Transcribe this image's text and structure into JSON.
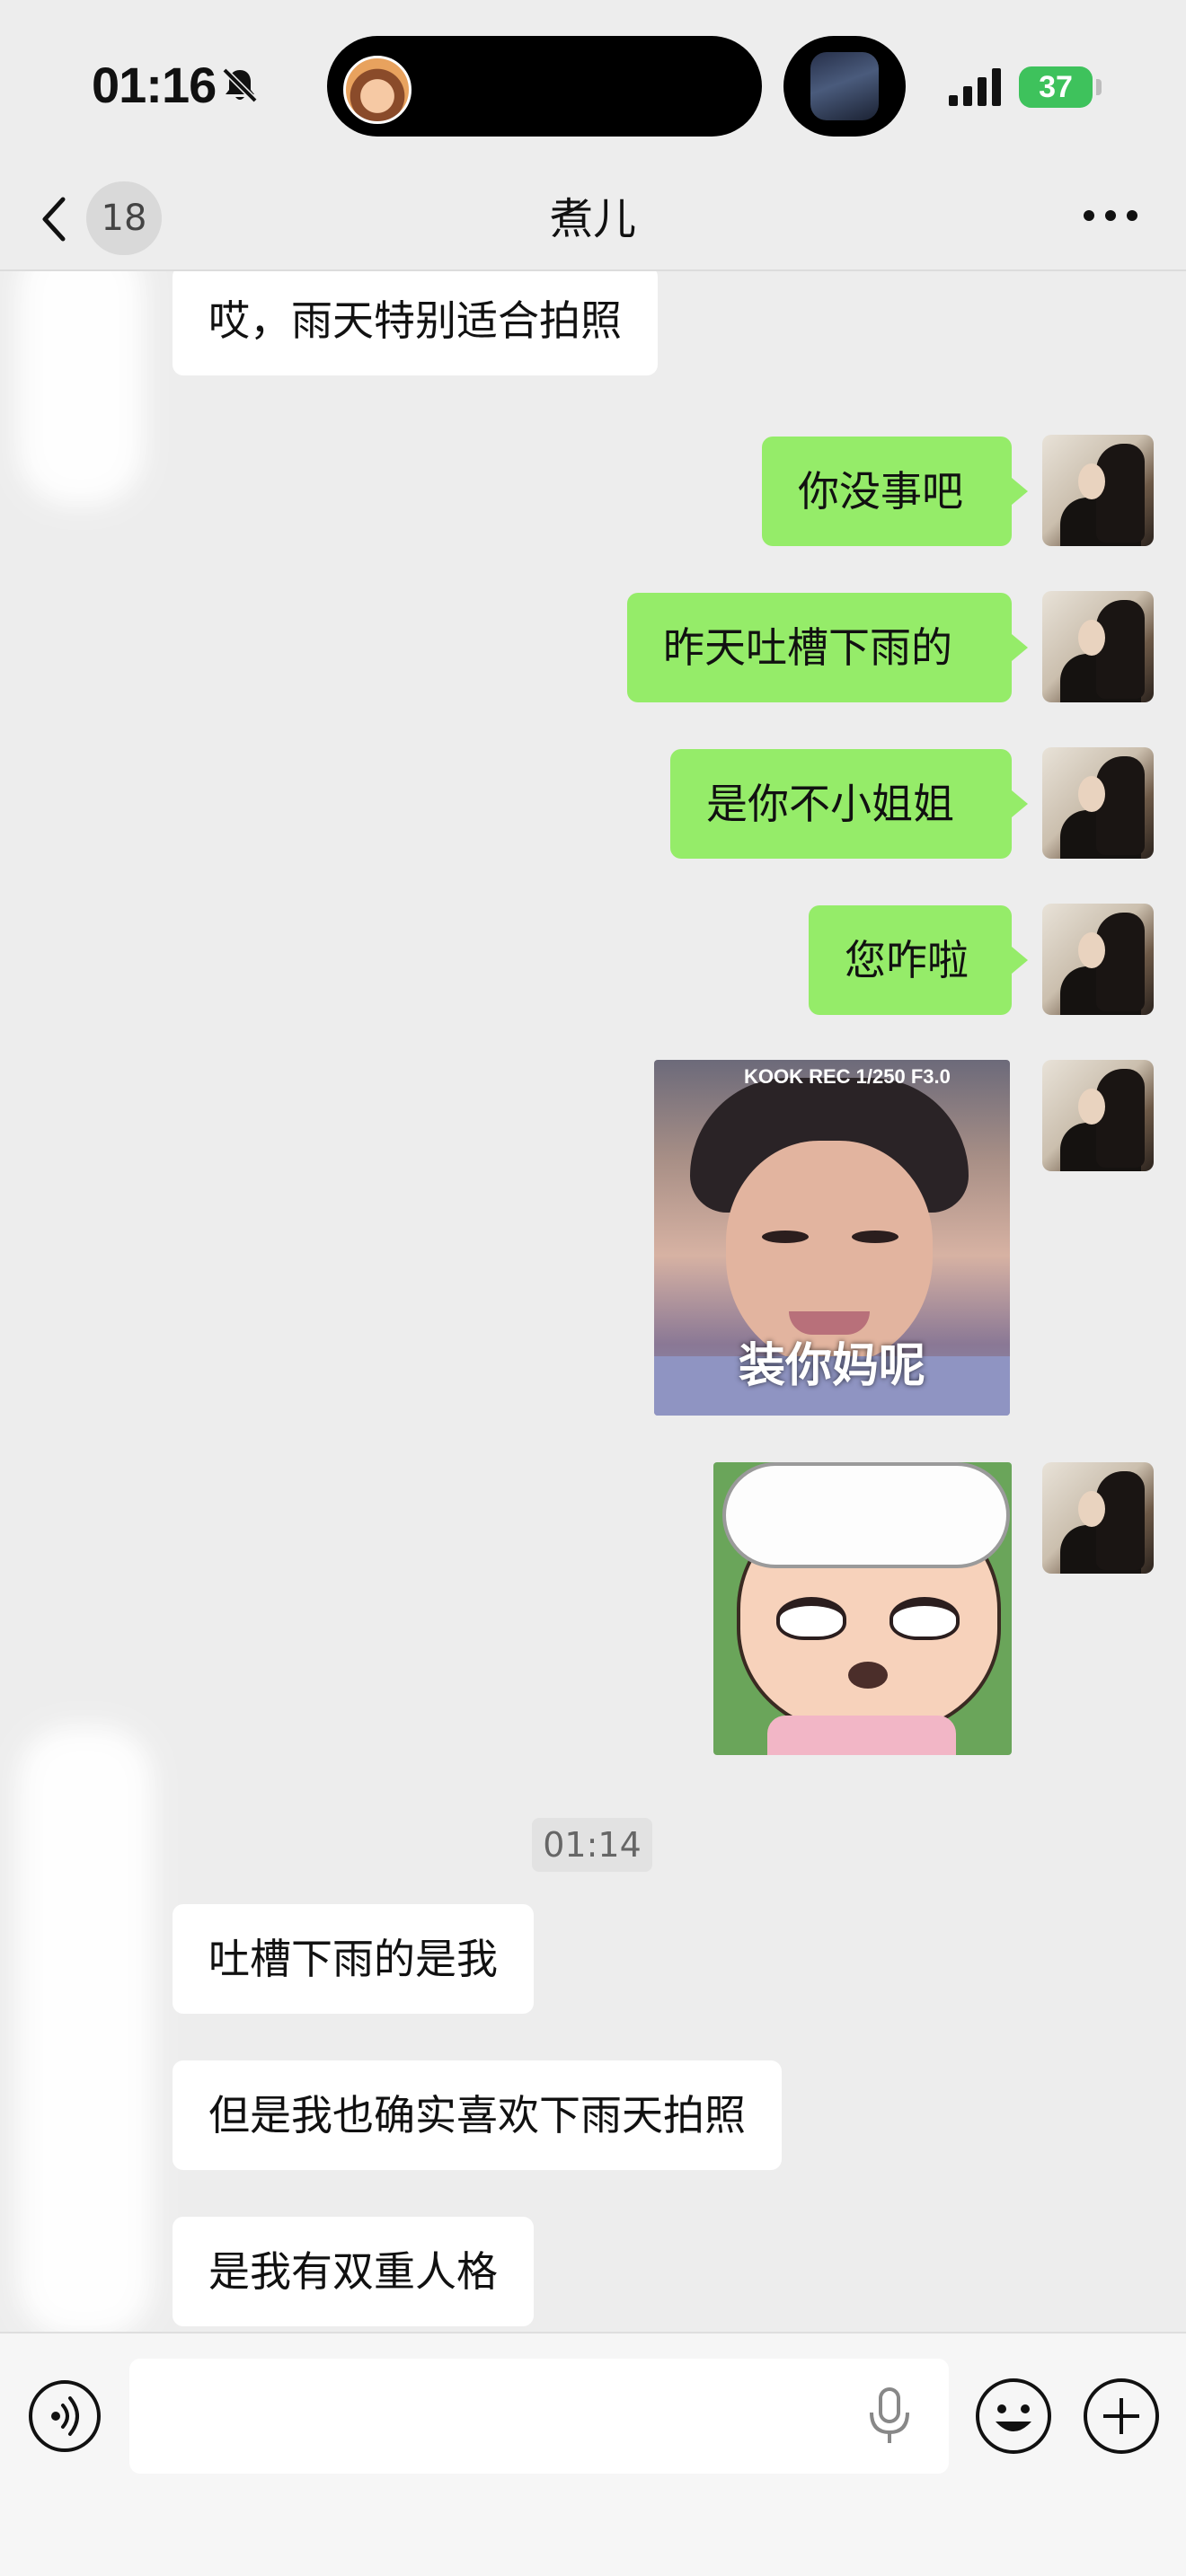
{
  "status_bar": {
    "time": "01:16",
    "battery": "37"
  },
  "nav": {
    "unread_count": "18",
    "title": "煮儿"
  },
  "messages": [
    {
      "side": "in",
      "text": "哎，雨天特别适合拍照"
    },
    {
      "side": "out",
      "text": "你没事吧"
    },
    {
      "side": "out",
      "text": "昨天吐槽下雨的"
    },
    {
      "side": "out",
      "text": "是你不小姐姐"
    },
    {
      "side": "out",
      "text": "您咋啦"
    },
    {
      "side": "out",
      "type": "sticker",
      "top_text": "KOOK  REC 1/250 F3.0",
      "caption": "装你妈呢"
    },
    {
      "side": "out",
      "type": "sticker"
    },
    {
      "side": "in",
      "text": "吐槽下雨的是我"
    },
    {
      "side": "in",
      "text": "但是我也确实喜欢下雨天拍照"
    },
    {
      "side": "in",
      "text": "是我有双重人格"
    }
  ],
  "timestamp": "01:14",
  "input": {
    "value": "",
    "placeholder": ""
  },
  "colors": {
    "background": "#ededed",
    "outgoing_bubble": "#95ec69",
    "incoming_bubble": "#ffffff",
    "battery": "#3ec25c"
  },
  "icons": [
    "bell-off-icon",
    "signal-icon",
    "back-icon",
    "more-icon",
    "voice-icon",
    "mic-icon",
    "emoji-icon",
    "plus-icon"
  ]
}
